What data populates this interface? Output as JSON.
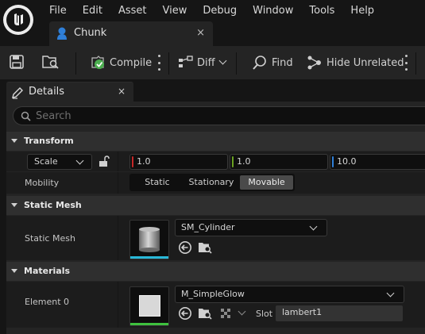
{
  "menu": {
    "items": [
      "File",
      "Edit",
      "Asset",
      "View",
      "Debug",
      "Window",
      "Tools",
      "Help"
    ]
  },
  "document_tab": {
    "label": "Chunk",
    "close_glyph": "×",
    "icon": "blueprint-icon"
  },
  "toolbar": {
    "compile_label": "Compile",
    "diff_label": "Diff",
    "find_label": "Find",
    "hide_unrelated_label": "Hide Unrelated"
  },
  "details_tab": {
    "label": "Details",
    "close_glyph": "×"
  },
  "search": {
    "placeholder": "Search"
  },
  "transform": {
    "header": "Transform",
    "scale_mode": "Scale",
    "scale_x": "1.0",
    "scale_y": "1.0",
    "scale_z": "10.0",
    "mobility_label": "Mobility",
    "mobility_options": [
      "Static",
      "Stationary",
      "Movable"
    ],
    "mobility_selected": "Movable"
  },
  "static_mesh": {
    "header": "Static Mesh",
    "row_label": "Static Mesh",
    "asset_name": "SM_Cylinder"
  },
  "materials": {
    "header": "Materials",
    "row_label": "Element 0",
    "asset_name": "M_SimpleGlow",
    "slot_label": "Slot",
    "slot_value": "lambert1"
  },
  "colors": {
    "axis_x": "#c62828",
    "axis_y": "#6aa121",
    "axis_z": "#2f7fd8",
    "mesh_underline": "#29b8d8",
    "material_underline": "#3ec13e",
    "compile_ok": "#4caf50"
  }
}
